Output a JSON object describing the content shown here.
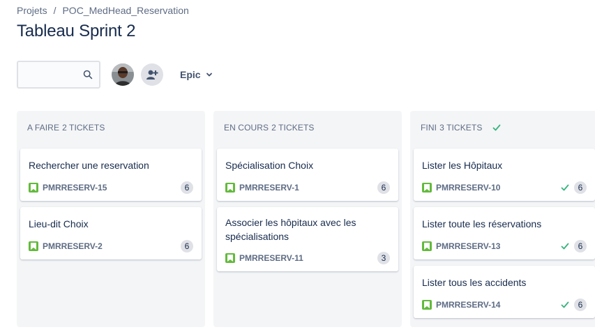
{
  "breadcrumb": {
    "items": [
      "Projets",
      "POC_MedHead_Reservation"
    ],
    "separator": "/"
  },
  "page_title": "Tableau Sprint 2",
  "toolbar": {
    "search": {
      "value": "",
      "placeholder": ""
    },
    "avatar_icon": "user-avatar",
    "add_person_icon": "add-person-icon",
    "epic_filter_label": "Epic"
  },
  "columns": [
    {
      "title": "A FAIRE",
      "count": "2 TICKETS",
      "done": false,
      "cards": [
        {
          "title": "Rechercher une reservation",
          "key": "PMRRESERV-15",
          "points": "6",
          "done": false
        },
        {
          "title": "Lieu-dit Choix",
          "key": "PMRRESERV-2",
          "points": "6",
          "done": false
        }
      ]
    },
    {
      "title": "EN COURS",
      "count": "2 TICKETS",
      "done": false,
      "cards": [
        {
          "title": "Spécialisation Choix",
          "key": "PMRRESERV-1",
          "points": "6",
          "done": false
        },
        {
          "title": "Associer les hôpitaux avec les spécialisations",
          "key": "PMRRESERV-11",
          "points": "3",
          "done": false
        }
      ]
    },
    {
      "title": "FINI",
      "count": "3 TICKETS",
      "done": true,
      "cards": [
        {
          "title": "Lister les Hôpitaux",
          "key": "PMRRESERV-10",
          "points": "6",
          "done": true
        },
        {
          "title": "Lister toute les réservations",
          "key": "PMRRESERV-13",
          "points": "6",
          "done": true
        },
        {
          "title": "Lister tous les accidents",
          "key": "PMRRESERV-14",
          "points": "6",
          "done": true
        }
      ]
    }
  ],
  "colors": {
    "story": "#63ba3c",
    "done_check": "#36b37e",
    "column_bg": "#f4f5f7",
    "text_primary": "#172b4d",
    "text_secondary": "#5e6c84"
  }
}
